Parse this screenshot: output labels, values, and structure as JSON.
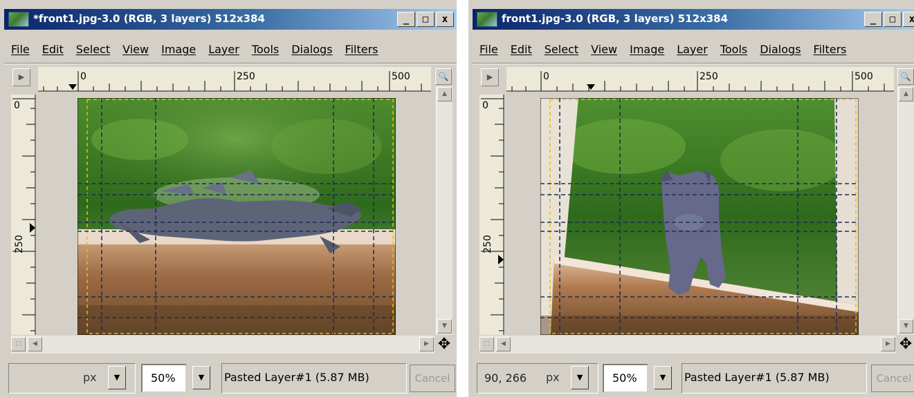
{
  "windows": [
    {
      "title": "*front1.jpg-3.0 (RGB, 3 layers) 512x384",
      "controls": {
        "minimize": "_",
        "maximize": "□",
        "close": "x"
      },
      "menu": [
        "File",
        "Edit",
        "Select",
        "View",
        "Image",
        "Layer",
        "Tools",
        "Dialogs",
        "Filters"
      ],
      "hruler_labels": [
        "0",
        "250",
        "500"
      ],
      "vruler_labels": [
        "0",
        "250"
      ],
      "coords": "",
      "unit": "px",
      "zoom": "50%",
      "status": "Pasted Layer#1 (5.87 MB)",
      "cancel": "Cancel"
    },
    {
      "title": "front1.jpg-3.0 (RGB, 3 layers) 512x384",
      "controls": {
        "minimize": "_",
        "maximize": "□",
        "close": "x"
      },
      "menu": [
        "File",
        "Edit",
        "Select",
        "View",
        "Image",
        "Layer",
        "Tools",
        "Dialogs",
        "Filters"
      ],
      "hruler_labels": [
        "0",
        "250",
        "500"
      ],
      "vruler_labels": [
        "0",
        "250"
      ],
      "coords": "90, 266",
      "unit": "px",
      "zoom": "50%",
      "status": "Pasted Layer#1 (5.87 MB)",
      "cancel": "Cancel"
    }
  ],
  "icons": {
    "app": "gimp-image-icon",
    "navigate": "navigate-icon",
    "zoom": "zoom-magnifier-icon",
    "quickmask": "quick-mask-icon",
    "move": "move-cross-icon",
    "dropdown": "triangle-down-icon"
  },
  "colors": {
    "titlebar_start": "#0a246a",
    "titlebar_end": "#a6caf0",
    "window_bg": "#d4d0c8",
    "guide": "#1a2a55"
  }
}
